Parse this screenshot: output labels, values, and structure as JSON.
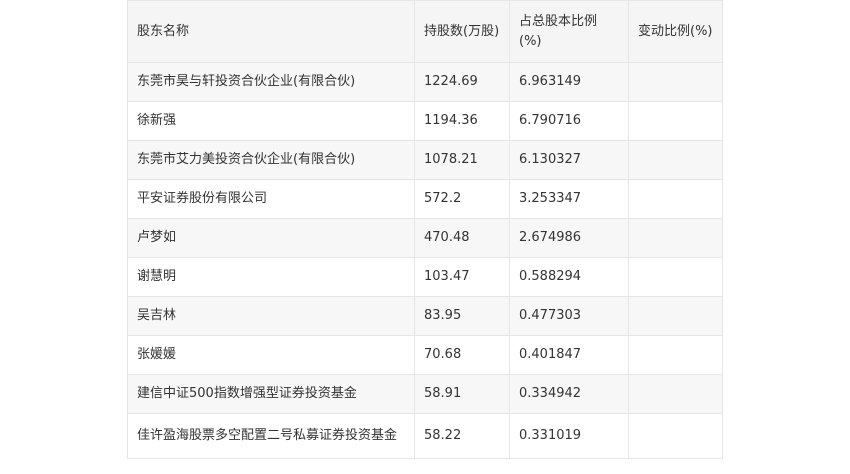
{
  "headers": {
    "name": "股东名称",
    "shares": "持股数(万股)",
    "ratio": "占总股本比例(%)",
    "change": "变动比例(%)"
  },
  "rows": [
    {
      "name": "东莞市昊与轩投资合伙企业(有限合伙)",
      "shares": "1224.69",
      "ratio": "6.963149",
      "change": ""
    },
    {
      "name": "徐新强",
      "shares": "1194.36",
      "ratio": "6.790716",
      "change": ""
    },
    {
      "name": "东莞市艾力美投资合伙企业(有限合伙)",
      "shares": "1078.21",
      "ratio": "6.130327",
      "change": ""
    },
    {
      "name": "平安证券股份有限公司",
      "shares": "572.2",
      "ratio": "3.253347",
      "change": ""
    },
    {
      "name": "卢梦如",
      "shares": "470.48",
      "ratio": "2.674986",
      "change": ""
    },
    {
      "name": "谢慧明",
      "shares": "103.47",
      "ratio": "0.588294",
      "change": ""
    },
    {
      "name": "吴吉林",
      "shares": "83.95",
      "ratio": "0.477303",
      "change": ""
    },
    {
      "name": "张媛媛",
      "shares": "70.68",
      "ratio": "0.401847",
      "change": ""
    },
    {
      "name": "建信中证500指数增强型证券投资基金",
      "shares": "58.91",
      "ratio": "0.334942",
      "change": ""
    },
    {
      "name": "佳许盈海股票多空配置二号私募证券投资基金",
      "shares": "58.22",
      "ratio": "0.331019",
      "change": ""
    }
  ]
}
